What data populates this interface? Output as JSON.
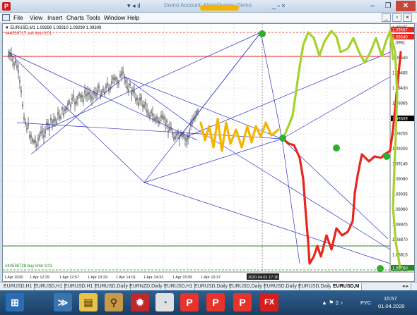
{
  "app": {
    "logo": "P"
  },
  "titlebar": {
    "quick_icons": "▾  ◂  ıl",
    "title_text": "Demo Account: MetaQuotes-Demo",
    "inner_controls": "_  ▫  ×",
    "minimize": "–",
    "maximize": "❐",
    "close": "✕"
  },
  "menu": {
    "items": [
      "File",
      "View",
      "Insert",
      "Charts",
      "Tools",
      "Window",
      "Help"
    ],
    "mdi_min": "_",
    "mdi_max": "▫",
    "mdi_close": "×"
  },
  "chart": {
    "header": "▼ EURUSD,M1  1.09299 1.09310 1.09299 1.09309",
    "sell_order": "#44536717 sell limit 0.01",
    "buy_order": "#44536728 buy limit 0.01",
    "price_labels": [
      "1.09605",
      "1.0961",
      "1.09540",
      "1.09485",
      "1.09430",
      "1.09365",
      "1.09320",
      "1.09255",
      "1.09200",
      "1.09145",
      "1.09090",
      "1.09035",
      "1.08980",
      "1.08925",
      "1.08870",
      "1.08815",
      "1.08760"
    ],
    "highlight_prices": [
      {
        "text": "1.09567",
        "color": "#e8261f"
      },
      {
        "text": "1.09540",
        "color": "#e8261f"
      },
      {
        "text": "1.09309",
        "color": "#000000"
      },
      {
        "text": "1.08760",
        "color": "#1f8a1f"
      }
    ],
    "time_labels": [
      "1 Apr 2020",
      "1 Apr 12:25",
      "1 Apr 12:57",
      "1 Apr 13:29",
      "1 Apr 14:01",
      "1 Apr 14:33",
      "1 Apr 15:05",
      "1 Apr 15:37"
    ],
    "crosshair_time": "2020.04.01 17:16",
    "colors": {
      "line": "#2b32c8",
      "sell": "#e8261f",
      "buy": "#1f8a1f",
      "yellow": "#f5b400",
      "red": "#e8261f",
      "lime": "#a6d12d",
      "green": "#2eaf2e"
    }
  },
  "tabs": [
    "EURUSD,H1",
    "EURUSD,H1",
    "EURUSD,H1",
    "EURUSD,Daily",
    "EURNZD,Daily",
    "EURUSD,H1",
    "EURUSD,Daily",
    "EURUSD,Daily",
    "EURUSD,Daily",
    "EURUSD,Daily",
    "EURUSD,M"
  ],
  "tab_scroll": "◂ ▸",
  "taskbar": {
    "icons": [
      {
        "name": "start-icon",
        "glyph": "⊞",
        "bg": "#2a6db5",
        "fg": "#ffffff"
      },
      {
        "name": "terminal-icon",
        "glyph": "≫",
        "bg": "#3a74b0",
        "fg": "#ffffff"
      },
      {
        "name": "folder-icon",
        "glyph": "▤",
        "bg": "#e8c24a",
        "fg": "#7a5a10"
      },
      {
        "name": "broom-icon",
        "glyph": "⚲",
        "bg": "#c79a4a",
        "fg": "#5a3a10"
      },
      {
        "name": "gear-icon",
        "glyph": "✹",
        "bg": "#c0262a",
        "fg": "#ffffff"
      },
      {
        "name": "chart-app-icon",
        "glyph": "◔",
        "bg": "#e0e0e0",
        "fg": "#2b7ac0"
      },
      {
        "name": "p-app-icon",
        "glyph": "P",
        "bg": "#e8332d",
        "fg": "#ffffff"
      },
      {
        "name": "p-app-icon-2",
        "glyph": "P",
        "bg": "#e8332d",
        "fg": "#ffffff"
      },
      {
        "name": "p-app-icon-3",
        "glyph": "P",
        "bg": "#e8332d",
        "fg": "#ffffff"
      },
      {
        "name": "fx-app-icon",
        "glyph": "FX",
        "bg": "#d41f1f",
        "fg": "#ffffff"
      }
    ],
    "tray_icons": "▲  ⚑  ▯  ♪",
    "lang": "РУС",
    "time": "15:57",
    "date": "01.04.2020"
  }
}
